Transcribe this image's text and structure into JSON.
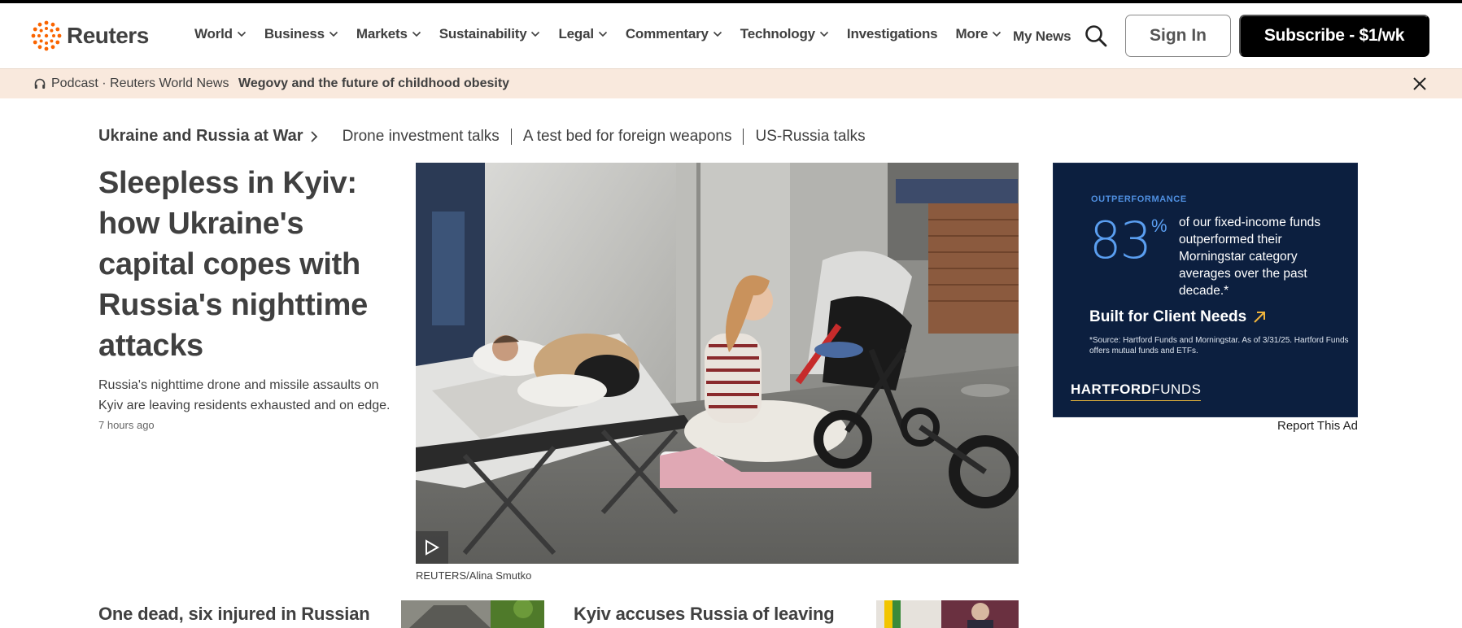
{
  "header": {
    "logo_text": "Reuters",
    "nav": [
      {
        "label": "World",
        "dropdown": true
      },
      {
        "label": "Business",
        "dropdown": true
      },
      {
        "label": "Markets",
        "dropdown": true
      },
      {
        "label": "Sustainability",
        "dropdown": true
      },
      {
        "label": "Legal",
        "dropdown": true
      },
      {
        "label": "Commentary",
        "dropdown": true
      },
      {
        "label": "Technology",
        "dropdown": true
      },
      {
        "label": "Investigations",
        "dropdown": false
      },
      {
        "label": "More",
        "dropdown": true
      }
    ],
    "my_news": "My News",
    "search_icon": "search-icon",
    "sign_in": "Sign In",
    "subscribe": "Subscribe - $1/wk"
  },
  "podcast": {
    "icon": "headphones-icon",
    "label": "Podcast · Reuters World News",
    "title": "Wegovy and the future of childhood obesity",
    "close_icon": "close-icon"
  },
  "topics": {
    "main": "Ukraine and Russia at War",
    "links": [
      "Drone investment talks",
      "A test bed for foreign weapons",
      "US-Russia talks"
    ]
  },
  "lead": {
    "title": "Sleepless in Kyiv: how Ukraine's capital copes with Russia's nighttime attacks",
    "description": "Russia's nighttime drone and missile assaults on Kyiv are leaving residents exhausted and on edge.",
    "time": "7 hours ago",
    "caption": "REUTERS/Alina Smutko",
    "play_icon": "play-icon"
  },
  "ad": {
    "kicker": "OUTPERFORMANCE",
    "big_number": "83",
    "percent": "%",
    "copy": "of our fixed-income funds outperformed their Morningstar category averages over the past decade.*",
    "cta": "Built for Client Needs",
    "source": "*Source: Hartford Funds and Morningstar. As of 3/31/25. Hartford Funds offers mutual funds and ETFs.",
    "brand_bold": "HARTFORD",
    "brand_light": "FUNDS",
    "report": "Report This Ad"
  },
  "secondary": [
    {
      "title": "One dead, six injured in Russian"
    },
    {
      "title": "Kyiv accuses Russia of leaving"
    }
  ],
  "colors": {
    "accent": "#fa6400",
    "text": "#404040",
    "podcast_bg": "#f9e9dd",
    "ad_bg": "#0c1f3f",
    "ad_blue": "#5a9ef0"
  }
}
